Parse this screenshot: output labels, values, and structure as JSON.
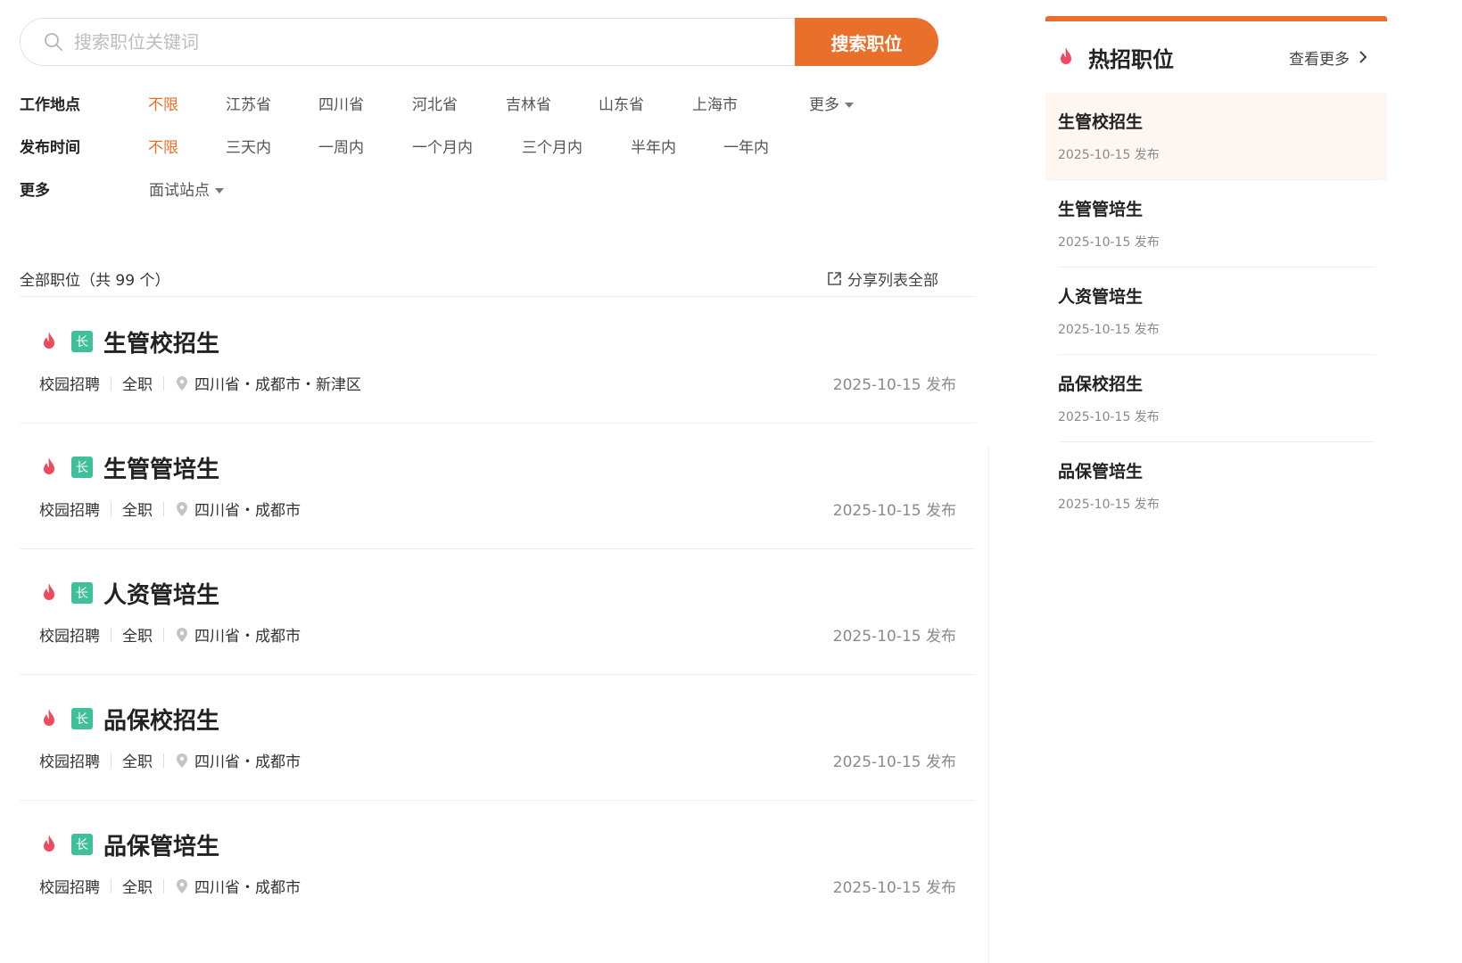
{
  "search": {
    "placeholder": "搜索职位关键词",
    "button_label": "搜索职位"
  },
  "filters": {
    "location": {
      "label": "工作地点",
      "options": [
        "不限",
        "江苏省",
        "四川省",
        "河北省",
        "吉林省",
        "山东省",
        "上海市"
      ],
      "more_label": "更多",
      "active": "不限"
    },
    "time": {
      "label": "发布时间",
      "options": [
        "不限",
        "三天内",
        "一周内",
        "一个月内",
        "三个月内",
        "半年内",
        "一年内"
      ],
      "active": "不限"
    },
    "more": {
      "label": "更多",
      "interview_label": "面试站点"
    }
  },
  "list": {
    "summary": "全部职位（共 99 个）",
    "share_label": "分享列表全部",
    "jobs": [
      {
        "title": "生管校招生",
        "tag": "长",
        "type": "校园招聘",
        "nature": "全职",
        "location": "四川省・成都市・新津区",
        "date": "2025-10-15 发布"
      },
      {
        "title": "生管管培生",
        "tag": "长",
        "type": "校园招聘",
        "nature": "全职",
        "location": "四川省・成都市",
        "date": "2025-10-15 发布"
      },
      {
        "title": "人资管培生",
        "tag": "长",
        "type": "校园招聘",
        "nature": "全职",
        "location": "四川省・成都市",
        "date": "2025-10-15 发布"
      },
      {
        "title": "品保校招生",
        "tag": "长",
        "type": "校园招聘",
        "nature": "全职",
        "location": "四川省・成都市",
        "date": "2025-10-15 发布"
      },
      {
        "title": "品保管培生",
        "tag": "长",
        "type": "校园招聘",
        "nature": "全职",
        "location": "四川省・成都市",
        "date": "2025-10-15 发布"
      }
    ]
  },
  "sidebar": {
    "title": "热招职位",
    "more_label": "查看更多",
    "items": [
      {
        "title": "生管校招生",
        "date": "2025-10-15 发布"
      },
      {
        "title": "生管管培生",
        "date": "2025-10-15 发布"
      },
      {
        "title": "人资管培生",
        "date": "2025-10-15 发布"
      },
      {
        "title": "品保校招生",
        "date": "2025-10-15 发布"
      },
      {
        "title": "品保管培生",
        "date": "2025-10-15 发布"
      }
    ]
  },
  "colors": {
    "accent": "#e8702a",
    "fire": "#f04a5e",
    "tag": "#3fbf9a",
    "highlight_bg": "#fdf6f1"
  },
  "icons": [
    "search-icon",
    "fire-icon",
    "tag-badge",
    "location-pin-icon",
    "share-icon",
    "chevron-right-icon",
    "caret-down-icon"
  ]
}
